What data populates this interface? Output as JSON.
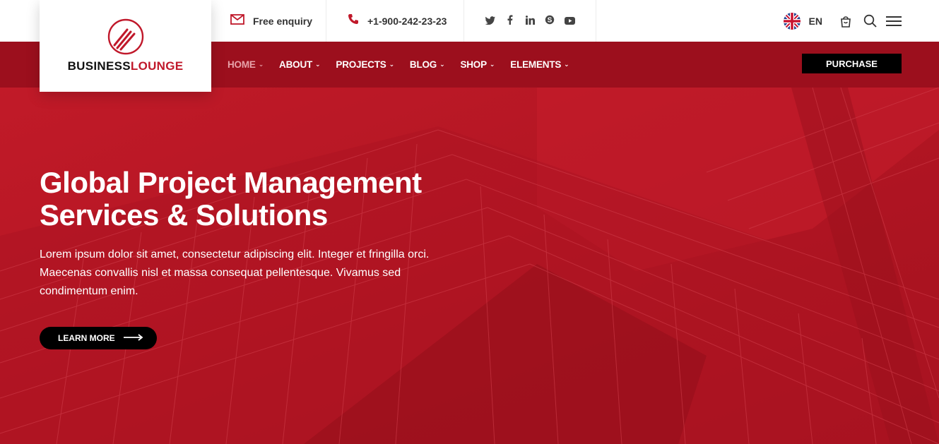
{
  "brand": {
    "name_part1": "BUSINESS",
    "name_part2": "LOUNGE",
    "accent": "#c0182a"
  },
  "topbar": {
    "enquiry": {
      "icon": "envelope-icon",
      "label": "Free enquiry"
    },
    "phone": {
      "icon": "phone-icon",
      "label": "+1-900-242-23-23"
    },
    "social": [
      "twitter-icon",
      "facebook-icon",
      "linkedin-icon",
      "skype-icon",
      "youtube-icon"
    ],
    "language": "EN"
  },
  "nav": {
    "items": [
      {
        "label": "HOME"
      },
      {
        "label": "ABOUT"
      },
      {
        "label": "PROJECTS"
      },
      {
        "label": "BLOG"
      },
      {
        "label": "SHOP"
      },
      {
        "label": "ELEMENTS"
      }
    ],
    "purchase": "PURCHASE"
  },
  "hero": {
    "title_line1": "Global Project Management",
    "title_line2": "Services & Solutions",
    "text_line1": "Lorem ipsum dolor sit amet, consectetur adipiscing elit. Integer et fringilla orci.",
    "text_line2": "Maecenas convallis nisl et massa consequat pellentesque. Vivamus sed",
    "text_line3": "condimentum enim.",
    "cta": "LEARN MORE"
  },
  "colors": {
    "hero": "#b81725",
    "navbar": "#9c0f1d",
    "dark": "#000000"
  }
}
